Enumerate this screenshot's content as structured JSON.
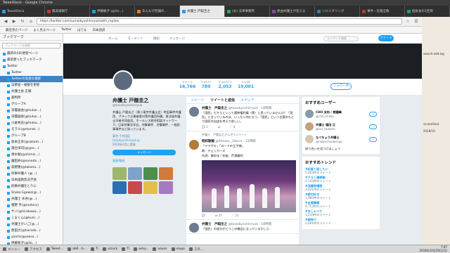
{
  "window_title": "TweetDeck - Google Chrome",
  "browser_title": "弁護士 戸舘圭之(@tosaikyoshinryuk) | Twitterからの投稿作ライト - Mozilla Firefox",
  "tabs": [
    {
      "label": "TweetDeck",
      "color": "#1da1f2"
    },
    {
      "label": "最高検察庁",
      "color": "#c0392b"
    },
    {
      "label": "伊藤敏子 (@ito...)",
      "color": "#1da1f2"
    },
    {
      "label": "あんなが翌鐘の...",
      "color": "#e67e22"
    },
    {
      "label": "弁護士 戸舘圭之",
      "color": "#1da1f2"
    },
    {
      "label": "(お) 法律事務所",
      "color": "#27ae60"
    },
    {
      "label": "熱血弁護士が答える",
      "color": "#8e44ad"
    },
    {
      "label": "シルミグリング",
      "color": "#2980b9"
    },
    {
      "label": "事件・危険全数",
      "color": "#c0392b"
    },
    {
      "label": "個会長の1回目",
      "color": "#16a085"
    }
  ],
  "url": "https://twitter.com/sumaikyoshinryuk/with_replies",
  "bookmarks_bar": [
    "最近見たページ",
    "よく見るページ",
    "Twitter",
    "はてな",
    "日本語訳"
  ],
  "sidebar": {
    "title": "ブックマーク",
    "search_placeholder": "ブックマークを検索",
    "items": [
      {
        "label": "最新の(ID)更新ページ",
        "selected": false
      },
      {
        "label": "最近使ったブックマーク",
        "selected": false
      },
      {
        "label": "Twitter",
        "selected": false
      },
      {
        "label": "Twitter",
        "selected": false
      },
      {
        "label": "Twitterの高速な検索",
        "selected": true
      },
      {
        "label": "法務省・検察を更新",
        "selected": false
      },
      {
        "label": "弁護士会 広報",
        "selected": false
      },
      {
        "label": "裁判所",
        "selected": false
      },
      {
        "label": "グループA",
        "selected": false
      },
      {
        "label": "深層論会(@hukai...)",
        "selected": false
      },
      {
        "label": "深層論会(@hukai...)",
        "selected": false
      },
      {
        "label": "小倉秀夫(@hideo...)",
        "selected": false
      },
      {
        "label": "モラル(@monet...)",
        "selected": false
      },
      {
        "label": "グループB",
        "selected": false
      },
      {
        "label": "坂本正幸(@sakam...)",
        "selected": false
      },
      {
        "label": "落合洋司(@yjoc...)",
        "selected": false
      },
      {
        "label": "清水勉(@shimiz...)",
        "selected": false
      },
      {
        "label": "園田寿(@sonoda...)",
        "selected": false
      },
      {
        "label": "高野隆(@takano...)",
        "selected": false
      },
      {
        "label": "刑事弁護人 (@...)",
        "selected": false
      },
      {
        "label": "日本国救急法学会",
        "selected": false
      },
      {
        "label": "刑事弁護をとりに",
        "selected": false
      },
      {
        "label": "Shoko Egawa(@...)",
        "selected": false
      },
      {
        "label": "弁護士 水谷(@...)",
        "selected": false
      },
      {
        "label": "猪野 亨(@inotoru)",
        "selected": false
      },
      {
        "label": "サイ(@hirakawa...)",
        "selected": false
      },
      {
        "label": "くまくん(@kum...)",
        "selected": false
      },
      {
        "label": "弁護士けいご(@...)",
        "selected": false
      },
      {
        "label": "原田大(@harada...)",
        "selected": false
      },
      {
        "label": "yoichi(@seesa...)",
        "selected": false
      },
      {
        "label": "伊藤和子(@ito...)",
        "selected": false
      },
      {
        "label": "弁護士パパ(@...)",
        "selected": false
      }
    ]
  },
  "twitter": {
    "nav": [
      "ホーム",
      "モーメント",
      "通知",
      "メッセージ"
    ],
    "search_placeholder": "キーワード検索",
    "tweet_button": "ツイート",
    "profile": {
      "name": "弁護士 戸舘圭之",
      "handle": "@tosaikyoshinryuk",
      "bio": "弁護士 戸舘圭之（第二東京弁護士会）袴田事件弁護団、ブラック企業被害対策弁護団所属。青法協弁護士学者合同部会。ホームレス総合相談ネットワーク。日本刑事法学会。刑事事件、労働事件、一般民事事件など扱っています。",
      "location": "東京 千代田区",
      "website": "tosaikyoshinryuk.jp",
      "joined": "2010年3月に登録",
      "message_button": "メッセージ",
      "media_label": "画像/動画"
    },
    "stats": [
      {
        "label": "ツイート",
        "value": "16,766"
      },
      {
        "label": "フォロー",
        "value": "780"
      },
      {
        "label": "フォロワー",
        "value": "2,053"
      },
      {
        "label": "いいね",
        "value": "19,001"
      }
    ],
    "follow_button": "フォロー中",
    "timeline_tabs": [
      "ツイート",
      "ツイートと返信",
      "メディア"
    ],
    "tweets": [
      {
        "author": "弁護士　戸舘圭之",
        "handle": "@tosaikyoshinryuk · 18時間",
        "text": "「国民」だからといって選挙権利権（票）と思っていませんか？「国民」と言っているのは、いったい何だろう。「国民」という言葉のもとで国民の自由を考えて欲しい。",
        "replies": "1",
        "retweets": "",
        "likes": "4"
      },
      {
        "retweet_note": "弁護士　戸舘圭之さんがリツイート",
        "author": "昭和歌謡",
        "handle": "@Showa__Dance · 12時間",
        "text": "「ヤマザキ」「ロードの王子様」",
        "subtext": "歌：チェッカーズ",
        "subtext2": "作詞：康珍化 / 作曲：芹澤廣明",
        "replies": "",
        "retweets": "23",
        "likes": "21"
      },
      {
        "author": "弁護士　戸舘圭之",
        "handle": "@tosaikyoshinryuk · 18時間",
        "text": "「国民」の部分がどうこの機会になっているかしら",
        "replies": "",
        "retweets": "",
        "likes": ""
      }
    ],
    "suggestions_title": "おすすめユーザー",
    "suggestions": [
      {
        "name": "CHO 友和 / 趙鍾峰",
        "handle": "@cho_shiwa"
      },
      {
        "name": "弁護士 福田 正",
        "handle": "@sei_tadashi"
      },
      {
        "name": "なべちょう弁護士",
        "handle": "@nabechoubengo"
      }
    ],
    "find_friends": "知り合いを見つけましょう",
    "trends_title": "おすすめトレンド",
    "trends": [
      {
        "name": "#紀香と話したい",
        "count": "5,003件のツイート"
      },
      {
        "name": "#アラン選挙戦",
        "count": "2,145件のツイート"
      },
      {
        "name": "#消費税増税",
        "count": "3,421件のツイート"
      },
      {
        "name": "#絶対好き",
        "count": "1,980件のツイート"
      },
      {
        "name": "#台風情報",
        "count": "4,712件のツイート"
      },
      {
        "name": "#おしゃべり",
        "count": "1,234件のツイート"
      },
      {
        "name": "#期待で",
        "count": "2,001件のツイート"
      }
    ]
  },
  "right_strip": [
    "screenShot",
    "2018/10",
    "search-add-log"
  ],
  "taskbar": {
    "items": [
      "メニュー",
      "アクセス",
      "Tweet...",
      "ab6 - b...",
      "Ti",
      "xclock",
      "Ti",
      "wmy...",
      "xeyes",
      "xlogo",
      "スタ..."
    ],
    "time": "7:07",
    "date": "2018年10月29日(月)"
  }
}
